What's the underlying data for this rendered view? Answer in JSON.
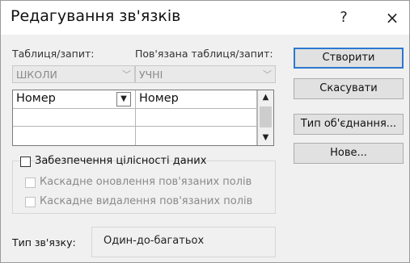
{
  "window": {
    "title": "Редагування зв'язків",
    "help": "?",
    "close": "×"
  },
  "labels": {
    "table": "Таблиця/запит:",
    "related_table": "Пов'язана таблиця/запит:"
  },
  "combos": {
    "table_value": "ШКОЛИ",
    "related_value": "УЧНІ"
  },
  "grid": {
    "rows": [
      {
        "left": "Номер",
        "right": "Номер"
      },
      {
        "left": "",
        "right": ""
      },
      {
        "left": "",
        "right": ""
      }
    ]
  },
  "options": {
    "integrity": "Забезпечення цілісності даних",
    "cascade_update": "Каскадне оновлення пов'язаних полів",
    "cascade_delete": "Каскадне видалення пов'язаних полів"
  },
  "relation_type": {
    "label": "Тип зв'язку:",
    "value": "Один-до-багатьох"
  },
  "buttons": {
    "create": "Створити",
    "cancel": "Скасувати",
    "join_type": "Тип об'єднання...",
    "new": "Нове..."
  },
  "colors": {
    "default_button_border": "#2b78d0",
    "dialog_bg": "#f0f0f0"
  },
  "icons": {
    "combo_arrow": "chevron-down-icon",
    "scroll_up": "chevron-up-icon",
    "scroll_down": "chevron-down-icon"
  }
}
